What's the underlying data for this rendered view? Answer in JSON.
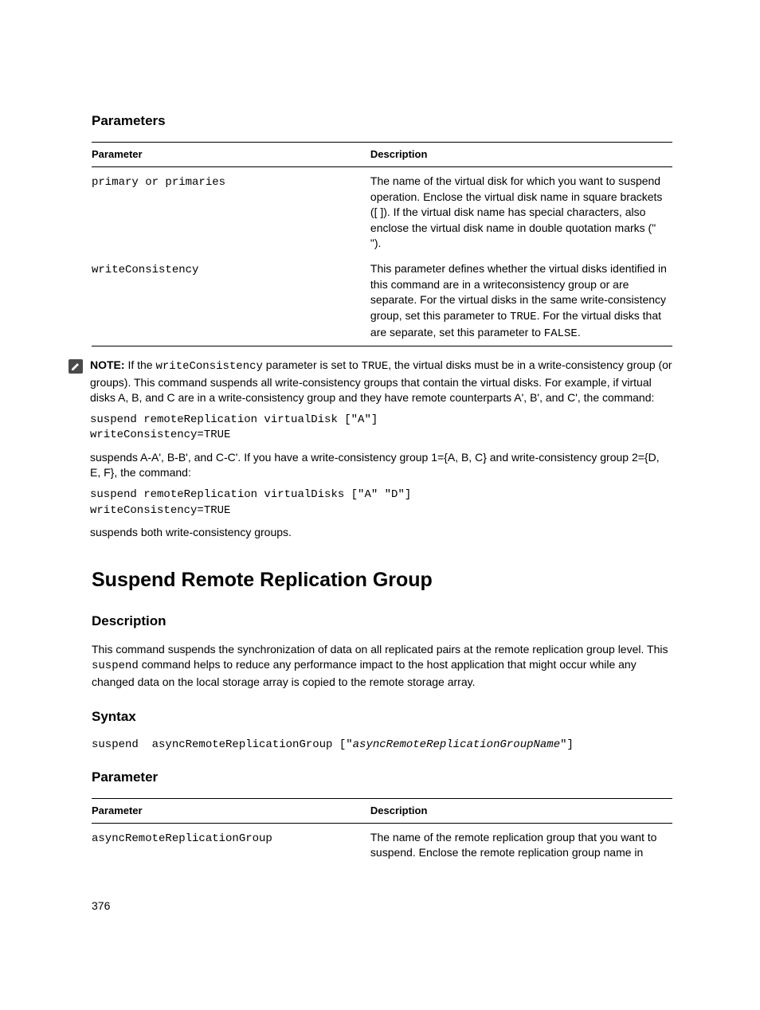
{
  "section1": {
    "heading": "Parameters",
    "col_param": "Parameter",
    "col_desc": "Description",
    "rows": [
      {
        "param": "primary or primaries",
        "desc": "The name of the virtual disk for which you want to suspend operation. Enclose the virtual disk name in square brackets ([ ]). If the virtual disk name has special characters, also enclose the virtual disk name in double quotation marks (\" \")."
      },
      {
        "param": "writeConsistency",
        "desc_pre": "This parameter defines whether the virtual disks identified in this command are in a writeconsistency group or are separate. For the virtual disks in the same write-consistency group, set this parameter to ",
        "val_true": "TRUE",
        "desc_mid": ". For the virtual disks that are separate, set this parameter to ",
        "val_false": "FALSE",
        "desc_post": "."
      }
    ]
  },
  "note": {
    "label": "NOTE: ",
    "pre": "If the ",
    "mono1": "writeConsistency",
    "mid1": " parameter is set to ",
    "mono2": "TRUE",
    "mid2": ", the virtual disks must be in a write-consistency group (or groups). This command suspends all write-consistency groups that contain the virtual disks. For example, if virtual disks A, B, and C are in a write-consistency group and they have remote counterparts A', B', and C', the command:",
    "cmd1": "suspend remoteReplication virtualDisk [\"A\"]\nwriteConsistency=TRUE",
    "para1": "suspends A-A', B-B', and C-C'. If you have a write-consistency group 1={A, B, C} and write-consistency group 2={D, E, F}, the command:",
    "cmd2": "suspend remoteReplication virtualDisks [\"A\" \"D\"]\nwriteConsistency=TRUE",
    "para2": "suspends both write-consistency groups."
  },
  "topic": {
    "title": "Suspend Remote Replication Group",
    "desc_heading": "Description",
    "desc_pre": "This command suspends the synchronization of data on all replicated pairs at the remote replication group level. This ",
    "desc_mono": "suspend",
    "desc_post": " command helps to reduce any performance impact to the host application that might occur while any changed data on the local storage array is copied to the remote storage array.",
    "syntax_heading": "Syntax",
    "syntax_pre": "suspend  asyncRemoteReplicationGroup [\"",
    "syntax_ital": "asyncRemoteReplicationGroupName",
    "syntax_post": "\"]",
    "param_heading": "Parameter",
    "col_param": "Parameter",
    "col_desc": "Description",
    "row": {
      "param": "asyncRemoteReplicationGroup",
      "desc": "The name of the remote replication group that you want to suspend. Enclose the remote replication group name in"
    }
  },
  "page_number": "376"
}
